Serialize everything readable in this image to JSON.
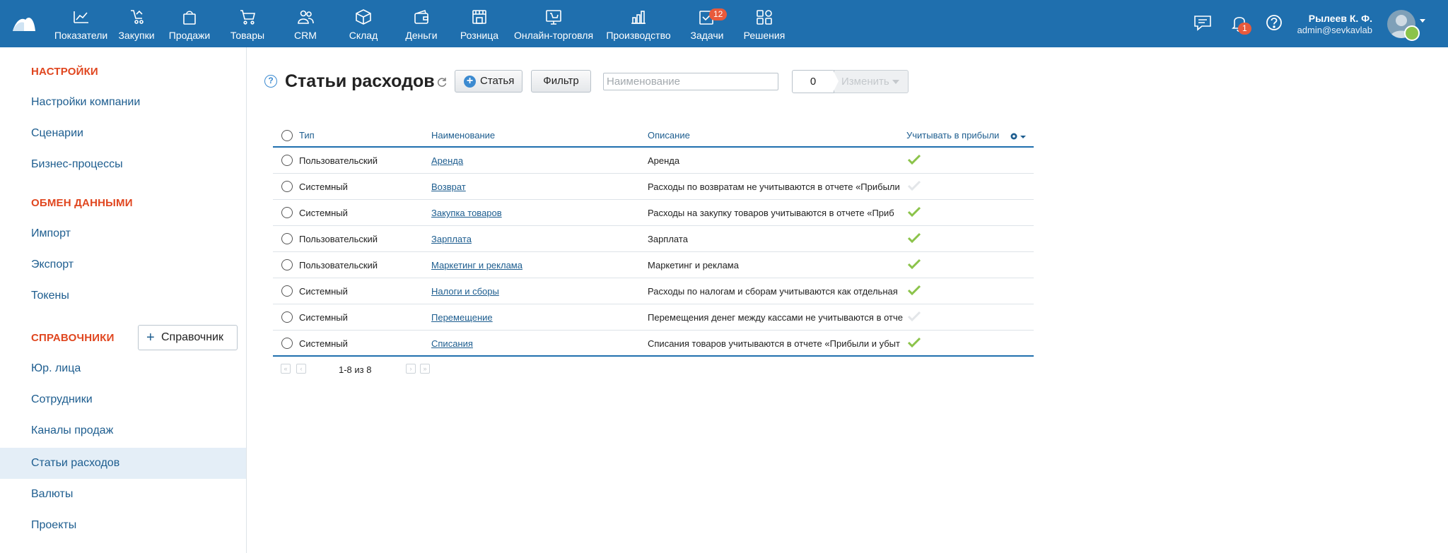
{
  "topbar": {
    "nav": [
      {
        "label": "Показатели",
        "icon": "chart-line-icon"
      },
      {
        "label": "Закупки",
        "icon": "purchases-icon"
      },
      {
        "label": "Продажи",
        "icon": "shopping-bag-icon"
      },
      {
        "label": "Товары",
        "icon": "cart-icon"
      },
      {
        "label": "CRM",
        "icon": "people-icon"
      },
      {
        "label": "Склад",
        "icon": "box-icon"
      },
      {
        "label": "Деньги",
        "icon": "wallet-icon"
      },
      {
        "label": "Розница",
        "icon": "store-icon"
      },
      {
        "label": "Онлайн-торговля",
        "icon": "online-store-icon"
      },
      {
        "label": "Производство",
        "icon": "production-icon"
      },
      {
        "label": "Задачи",
        "icon": "tasks-icon",
        "badge": "12"
      },
      {
        "label": "Решения",
        "icon": "apps-icon"
      }
    ],
    "notifications_badge": "1",
    "user": {
      "name": "Рылеев К. Ф.",
      "email": "admin@sevkavlab"
    }
  },
  "sidebar": {
    "sections": [
      {
        "title": "НАСТРОЙКИ",
        "items": [
          "Настройки компании",
          "Сценарии",
          "Бизнес-процессы"
        ]
      },
      {
        "title": "ОБМЕН ДАННЫМИ",
        "items": [
          "Импорт",
          "Экспорт",
          "Токены"
        ]
      },
      {
        "title": "СПРАВОЧНИКИ",
        "items": [
          "Юр. лица",
          "Сотрудники",
          "Каналы продаж",
          "Статьи расходов",
          "Валюты",
          "Проекты"
        ]
      }
    ],
    "add_directory_label": "Справочник",
    "active_item": "Статьи расходов"
  },
  "main": {
    "title": "Статьи расходов",
    "add_button": "Статья",
    "filter_button": "Фильтр",
    "search_placeholder": "Наименование",
    "selected_count": "0",
    "change_button": "Изменить"
  },
  "table": {
    "columns": {
      "type": "Тип",
      "name": "Наименование",
      "description": "Описание",
      "profit": "Учитывать в прибыли"
    },
    "rows": [
      {
        "type": "Пользовательский",
        "name": "Аренда",
        "description": "Аренда",
        "profit": true
      },
      {
        "type": "Системный",
        "name": "Возврат",
        "description": "Расходы по возвратам не учитываются в отчете «Прибыли",
        "profit": false
      },
      {
        "type": "Системный",
        "name": "Закупка товаров",
        "description": "Расходы на закупку товаров учитываются в отчете «Приб",
        "profit": true
      },
      {
        "type": "Пользовательский",
        "name": "Зарплата",
        "description": "Зарплата",
        "profit": true
      },
      {
        "type": "Пользовательский",
        "name": "Маркетинг и реклама",
        "description": "Маркетинг и реклама",
        "profit": true
      },
      {
        "type": "Системный",
        "name": "Налоги и сборы",
        "description": "Расходы по налогам и сборам учитываются как отдельная",
        "profit": true
      },
      {
        "type": "Системный",
        "name": "Перемещение",
        "description": "Перемещения денег между кассами не учитываются в отче",
        "profit": false
      },
      {
        "type": "Системный",
        "name": "Списания",
        "description": "Списания товаров учитываются в отчете «Прибыли и убыт",
        "profit": true
      }
    ],
    "pagination": "1-8 из 8"
  },
  "colors": {
    "topbar": "#1f6fae",
    "accent": "#e0461f",
    "link": "#1d5d8f",
    "check_on": "#8bc34a",
    "check_off": "#e3e6e9"
  }
}
